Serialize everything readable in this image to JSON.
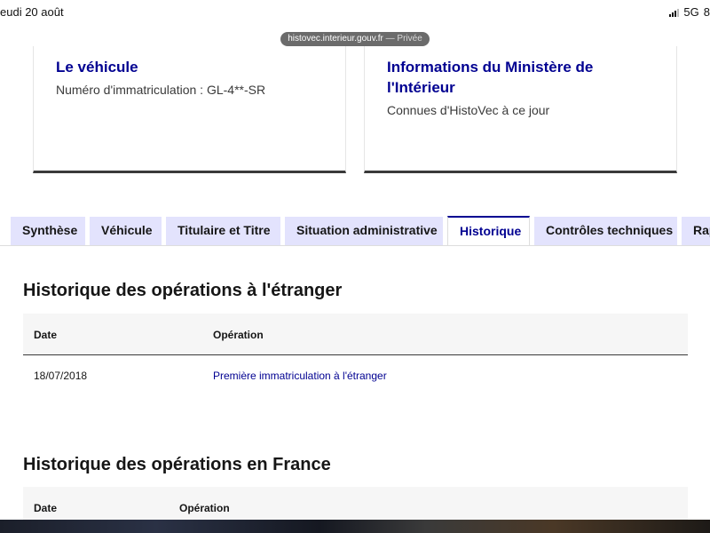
{
  "status_bar": {
    "time_label": "eudi 20 août",
    "network": "5G",
    "battery": "8"
  },
  "browser": {
    "url": "histovec.interieur.gouv.fr",
    "mode": "— Privée"
  },
  "cards": [
    {
      "title": "Le véhicule",
      "description": "Numéro d'immatriculation : GL-4**-SR"
    },
    {
      "title": "Informations du Ministère de l'Intérieur",
      "description": "Connues d'HistoVec à ce jour"
    }
  ],
  "tabs": [
    {
      "label": "Synthèse",
      "active": false
    },
    {
      "label": "Véhicule",
      "active": false
    },
    {
      "label": "Titulaire et Titre",
      "active": false
    },
    {
      "label": "Situation administrative",
      "active": false
    },
    {
      "label": "Historique",
      "active": true
    },
    {
      "label": "Contrôles techniques",
      "active": false
    },
    {
      "label": "Rap",
      "active": false
    }
  ],
  "sections": [
    {
      "title": "Historique des opérations à l'étranger",
      "columns": [
        "Date",
        "Opération"
      ],
      "rows": [
        {
          "date": "18/07/2018",
          "operation": "Première immatriculation à l'étranger"
        }
      ]
    },
    {
      "title": "Historique des opérations en France",
      "columns": [
        "Date",
        "Opération"
      ],
      "rows": []
    }
  ],
  "colors": {
    "brand_blue": "#000091",
    "tab_inactive_bg": "#e3e3fd",
    "table_header_bg": "#f6f6f6"
  }
}
